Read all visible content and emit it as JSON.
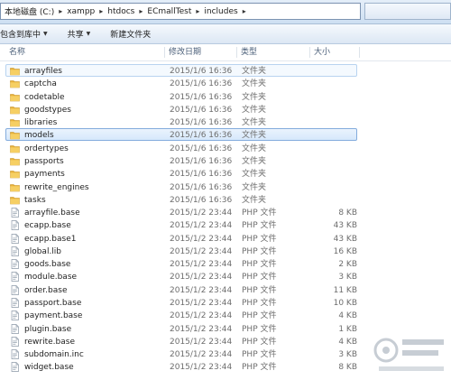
{
  "address": {
    "crumbs": [
      "本地磁盘 (C:)",
      "xampp",
      "htdocs",
      "ECmallTest",
      "includes"
    ]
  },
  "toolbar": {
    "include_label": "包含到库中",
    "share_label": "共享",
    "new_folder_label": "新建文件夹"
  },
  "columns": {
    "name": "名称",
    "date": "修改日期",
    "type": "类型",
    "size": "大小"
  },
  "files": [
    {
      "name": "arrayfiles",
      "date": "2015/1/6 16:36",
      "type": "文件夹",
      "size": "",
      "kind": "folder-icon",
      "state": "hover"
    },
    {
      "name": "captcha",
      "date": "2015/1/6 16:36",
      "type": "文件夹",
      "size": "",
      "kind": "folder-icon",
      "state": ""
    },
    {
      "name": "codetable",
      "date": "2015/1/6 16:36",
      "type": "文件夹",
      "size": "",
      "kind": "folder-icon",
      "state": ""
    },
    {
      "name": "goodstypes",
      "date": "2015/1/6 16:36",
      "type": "文件夹",
      "size": "",
      "kind": "folder-icon",
      "state": ""
    },
    {
      "name": "libraries",
      "date": "2015/1/6 16:36",
      "type": "文件夹",
      "size": "",
      "kind": "folder-icon",
      "state": ""
    },
    {
      "name": "models",
      "date": "2015/1/6 16:36",
      "type": "文件夹",
      "size": "",
      "kind": "folder-icon",
      "state": "selected"
    },
    {
      "name": "ordertypes",
      "date": "2015/1/6 16:36",
      "type": "文件夹",
      "size": "",
      "kind": "folder-icon",
      "state": ""
    },
    {
      "name": "passports",
      "date": "2015/1/6 16:36",
      "type": "文件夹",
      "size": "",
      "kind": "folder-icon",
      "state": ""
    },
    {
      "name": "payments",
      "date": "2015/1/6 16:36",
      "type": "文件夹",
      "size": "",
      "kind": "folder-icon",
      "state": ""
    },
    {
      "name": "rewrite_engines",
      "date": "2015/1/6 16:36",
      "type": "文件夹",
      "size": "",
      "kind": "folder-icon",
      "state": ""
    },
    {
      "name": "tasks",
      "date": "2015/1/6 16:36",
      "type": "文件夹",
      "size": "",
      "kind": "folder-icon",
      "state": ""
    },
    {
      "name": "arrayfile.base",
      "date": "2015/1/2 23:44",
      "type": "PHP 文件",
      "size": "8 KB",
      "kind": "file-icon",
      "state": ""
    },
    {
      "name": "ecapp.base",
      "date": "2015/1/2 23:44",
      "type": "PHP 文件",
      "size": "43 KB",
      "kind": "file-icon",
      "state": ""
    },
    {
      "name": "ecapp.base1",
      "date": "2015/1/2 23:44",
      "type": "PHP 文件",
      "size": "43 KB",
      "kind": "file-icon",
      "state": ""
    },
    {
      "name": "global.lib",
      "date": "2015/1/2 23:44",
      "type": "PHP 文件",
      "size": "16 KB",
      "kind": "file-icon",
      "state": ""
    },
    {
      "name": "goods.base",
      "date": "2015/1/2 23:44",
      "type": "PHP 文件",
      "size": "2 KB",
      "kind": "file-icon",
      "state": ""
    },
    {
      "name": "module.base",
      "date": "2015/1/2 23:44",
      "type": "PHP 文件",
      "size": "3 KB",
      "kind": "file-icon",
      "state": ""
    },
    {
      "name": "order.base",
      "date": "2015/1/2 23:44",
      "type": "PHP 文件",
      "size": "11 KB",
      "kind": "file-icon",
      "state": ""
    },
    {
      "name": "passport.base",
      "date": "2015/1/2 23:44",
      "type": "PHP 文件",
      "size": "10 KB",
      "kind": "file-icon",
      "state": ""
    },
    {
      "name": "payment.base",
      "date": "2015/1/2 23:44",
      "type": "PHP 文件",
      "size": "4 KB",
      "kind": "file-icon",
      "state": ""
    },
    {
      "name": "plugin.base",
      "date": "2015/1/2 23:44",
      "type": "PHP 文件",
      "size": "1 KB",
      "kind": "file-icon",
      "state": ""
    },
    {
      "name": "rewrite.base",
      "date": "2015/1/2 23:44",
      "type": "PHP 文件",
      "size": "4 KB",
      "kind": "file-icon",
      "state": ""
    },
    {
      "name": "subdomain.inc",
      "date": "2015/1/2 23:44",
      "type": "PHP 文件",
      "size": "3 KB",
      "kind": "file-icon",
      "state": ""
    },
    {
      "name": "widget.base",
      "date": "2015/1/2 23:44",
      "type": "PHP 文件",
      "size": "8 KB",
      "kind": "file-icon",
      "state": ""
    }
  ],
  "colors": {
    "folder": "#e8b23a",
    "selection": "#d6e8fb",
    "selection_border": "#84acdd"
  }
}
